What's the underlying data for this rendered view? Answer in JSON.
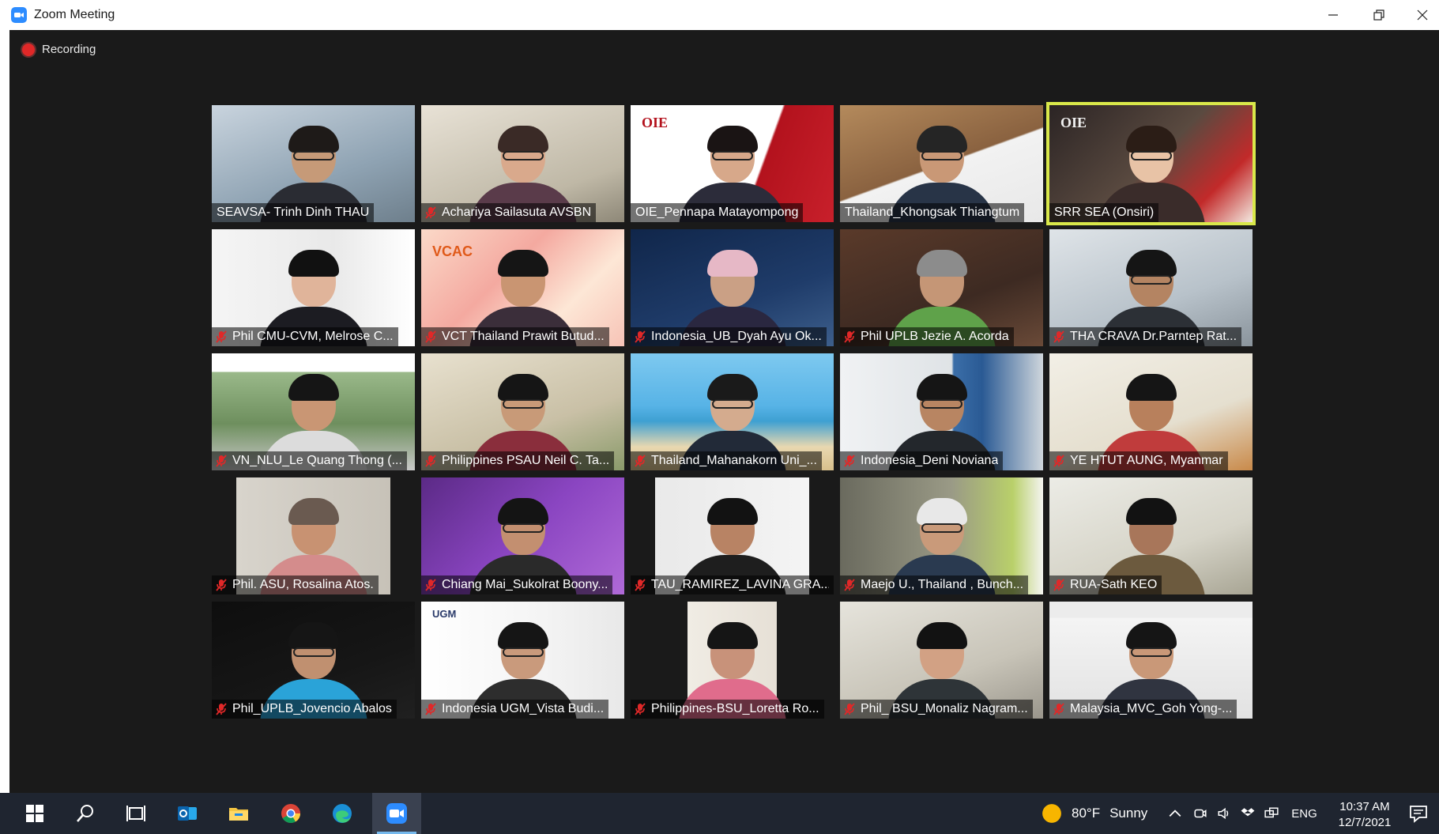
{
  "window": {
    "title": "Zoom Meeting"
  },
  "recording": {
    "label": "Recording"
  },
  "participants": [
    {
      "name": "SEAVSA- Trinh Dinh THAU",
      "muted": false,
      "active": false
    },
    {
      "name": "Achariya Sailasuta AVSBN",
      "muted": true,
      "active": false
    },
    {
      "name": "OIE_Pennapa Matayompong",
      "muted": false,
      "active": false
    },
    {
      "name": "Thailand_Khongsak Thiangtum",
      "muted": false,
      "active": false
    },
    {
      "name": "SRR SEA (Onsiri)",
      "muted": false,
      "active": true
    },
    {
      "name": "Phil CMU-CVM, Melrose C...",
      "muted": true,
      "active": false
    },
    {
      "name": "VCT Thailand Prawit Butud...",
      "muted": true,
      "active": false
    },
    {
      "name": "Indonesia_UB_Dyah Ayu Ok...",
      "muted": true,
      "active": false
    },
    {
      "name": "Phil UPLB Jezie A. Acorda",
      "muted": true,
      "active": false
    },
    {
      "name": "THA CRAVA Dr.Parntep Rat...",
      "muted": true,
      "active": false
    },
    {
      "name": "VN_NLU_Le Quang Thong (...",
      "muted": true,
      "active": false
    },
    {
      "name": "Philippines PSAU Neil C. Ta...",
      "muted": true,
      "active": false
    },
    {
      "name": "Thailand_Mahanakorn Uni_...",
      "muted": true,
      "active": false
    },
    {
      "name": "Indonesia_Deni Noviana",
      "muted": true,
      "active": false
    },
    {
      "name": "YE HTUT AUNG, Myanmar",
      "muted": true,
      "active": false
    },
    {
      "name": "Phil. ASU, Rosalina Atos.",
      "muted": true,
      "active": false
    },
    {
      "name": "Chiang Mai_Sukolrat Boony...",
      "muted": true,
      "active": false
    },
    {
      "name": "TAU_RAMIREZ_LAVINA GRA...",
      "muted": true,
      "active": false
    },
    {
      "name": "Maejo U., Thailand , Bunch...",
      "muted": true,
      "active": false
    },
    {
      "name": "RUA-Sath KEO",
      "muted": true,
      "active": false
    },
    {
      "name": "Phil_UPLB_Jovencio Abalos",
      "muted": true,
      "active": false
    },
    {
      "name": "Indonesia UGM_Vista Budi...",
      "muted": true,
      "active": false
    },
    {
      "name": "Philippines-BSU_Loretta Ro...",
      "muted": true,
      "active": false
    },
    {
      "name": "Phil_ BSU_Monaliz Nagram...",
      "muted": true,
      "active": false
    },
    {
      "name": "Malaysia_MVC_Goh Yong-...",
      "muted": true,
      "active": false
    }
  ],
  "tile_logos": {
    "t2": "OIE",
    "t4": "OIE",
    "t6": "VCAC",
    "t21": "UGM"
  },
  "taskbar": {
    "apps": [
      "start-icon",
      "search-icon",
      "task-view-icon",
      "outlook-icon",
      "file-explorer-icon",
      "chrome-icon",
      "edge-icon",
      "zoom-icon"
    ],
    "active_app": "zoom-icon"
  },
  "tray": {
    "weather_temp": "80°F",
    "weather_desc": "Sunny",
    "language": "ENG",
    "time": "10:37 AM",
    "date": "12/7/2021"
  },
  "colors": {
    "meeting_bg": "#1a1a1a",
    "active_speaker": "#d9e84a",
    "muted_icon": "#e02828",
    "taskbar_bg": "#1f2530"
  }
}
